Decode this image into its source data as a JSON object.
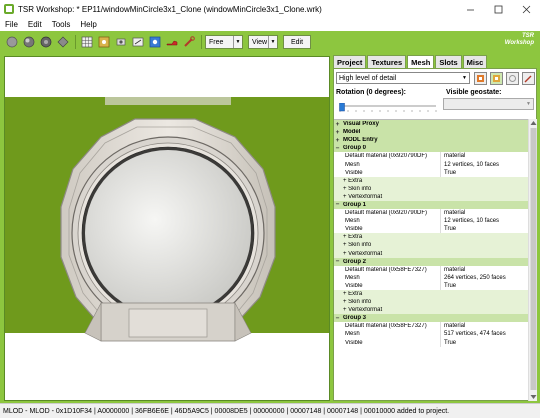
{
  "window": {
    "title": "TSR Workshop: * EP11/windowMinCircle3x1_Clone (windowMinCircle3x1_Clone.wrk)",
    "minimize_icon": "minimize-icon",
    "maximize_icon": "maximize-icon",
    "close_icon": "close-icon"
  },
  "menu": [
    "File",
    "Edit",
    "Tools",
    "Help"
  ],
  "toolbar": {
    "mode_value": "Free",
    "view_label": "View",
    "edit_label": "Edit",
    "logo_line1": "TSR",
    "logo_line2": "Workshop"
  },
  "tabs": [
    "Project",
    "Textures",
    "Mesh",
    "Slots",
    "Misc"
  ],
  "active_tab": "Mesh",
  "mesh": {
    "lod_value": "High level of detail",
    "rotation_label": "Rotation (0 degrees):",
    "rotation_value": 0,
    "geostate_label": "Visible geostate:"
  },
  "tree": [
    {
      "kind": "sec",
      "toggle": "+",
      "label": "Visual Proxy"
    },
    {
      "kind": "sec",
      "toggle": "+",
      "label": "Model"
    },
    {
      "kind": "sec",
      "toggle": "+",
      "label": "MODL Entry"
    },
    {
      "kind": "sec",
      "toggle": "−",
      "label": "Group 0"
    },
    {
      "kind": "prop",
      "label": "Default material (0x920790DF)",
      "value": "material"
    },
    {
      "kind": "prop",
      "label": "Mesh",
      "value": "12 vertices, 10 faces"
    },
    {
      "kind": "prop",
      "label": "Visible",
      "value": "True"
    },
    {
      "kind": "sub",
      "label": "+ Extra"
    },
    {
      "kind": "sub",
      "label": "+ Skin info"
    },
    {
      "kind": "sub",
      "label": "+ Vertexformat"
    },
    {
      "kind": "sec",
      "toggle": "−",
      "label": "Group 1"
    },
    {
      "kind": "prop",
      "label": "Default material (0x920790DF)",
      "value": "material"
    },
    {
      "kind": "prop",
      "label": "Mesh",
      "value": "12 vertices, 10 faces"
    },
    {
      "kind": "prop",
      "label": "Visible",
      "value": "True"
    },
    {
      "kind": "sub",
      "label": "+ Extra"
    },
    {
      "kind": "sub",
      "label": "+ Skin info"
    },
    {
      "kind": "sub",
      "label": "+ Vertexformat"
    },
    {
      "kind": "sec",
      "toggle": "−",
      "label": "Group 2"
    },
    {
      "kind": "prop",
      "label": "Default material (0x58FE7327)",
      "value": "material"
    },
    {
      "kind": "prop",
      "label": "Mesh",
      "value": "264 vertices, 250 faces"
    },
    {
      "kind": "prop",
      "label": "Visible",
      "value": "True"
    },
    {
      "kind": "sub",
      "label": "+ Extra"
    },
    {
      "kind": "sub",
      "label": "+ Skin info"
    },
    {
      "kind": "sub",
      "label": "+ Vertexformat"
    },
    {
      "kind": "sec",
      "toggle": "−",
      "label": "Group 3"
    },
    {
      "kind": "prop",
      "label": "Default material (0x58FE7327)",
      "value": "material"
    },
    {
      "kind": "prop",
      "label": "Mesh",
      "value": "517 vertices, 474 faces"
    },
    {
      "kind": "prop",
      "label": "Visible",
      "value": "True"
    }
  ],
  "status": "MLOD - MLOD - 0x1D10F34 | A0000000 | 36FB6E6E | 46D5A9C5 | 00008DE5 | 00000000 | 00007148 | 00007148 | 00010000 added to project.",
  "colors": {
    "accent": "#8dc63f",
    "sky": "#ffffff",
    "ground": "#6f9a1c",
    "section": "#c9e3a8"
  }
}
